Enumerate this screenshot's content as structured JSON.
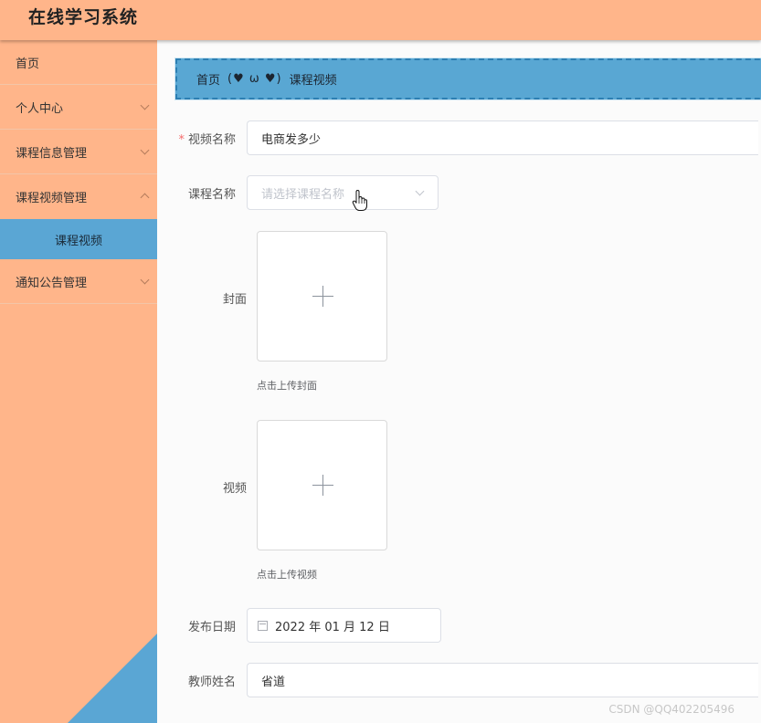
{
  "app": {
    "title": "在线学习系统"
  },
  "sidebar": {
    "items": [
      {
        "label": "首页",
        "has_children": false
      },
      {
        "label": "个人中心",
        "has_children": true
      },
      {
        "label": "课程信息管理",
        "has_children": true
      },
      {
        "label": "课程视频管理",
        "has_children": true,
        "expanded": true
      },
      {
        "label": "通知公告管理",
        "has_children": true
      }
    ],
    "active_sub_item": "课程视频"
  },
  "breadcrumb": {
    "home": "首页",
    "emoticon": "(♥ ω ♥)",
    "current": "课程视频"
  },
  "form": {
    "video_name": {
      "label": "视频名称",
      "required": true,
      "value": "电商发多少"
    },
    "course_name": {
      "label": "课程名称",
      "placeholder": "请选择课程名称"
    },
    "cover": {
      "label": "封面",
      "tip": "点击上传封面"
    },
    "video": {
      "label": "视频",
      "tip": "点击上传视频"
    },
    "publish_date": {
      "label": "发布日期",
      "value": "2022 年 01 月 12 日"
    },
    "teacher_name": {
      "label": "教师姓名",
      "value": "省道"
    }
  },
  "watermark": "CSDN @QQ402205496",
  "colors": {
    "topbar": "#ffb58a",
    "sidebar": "#ffb58a",
    "accent_blue": "#5aa6d4",
    "required": "#f56c6c"
  }
}
